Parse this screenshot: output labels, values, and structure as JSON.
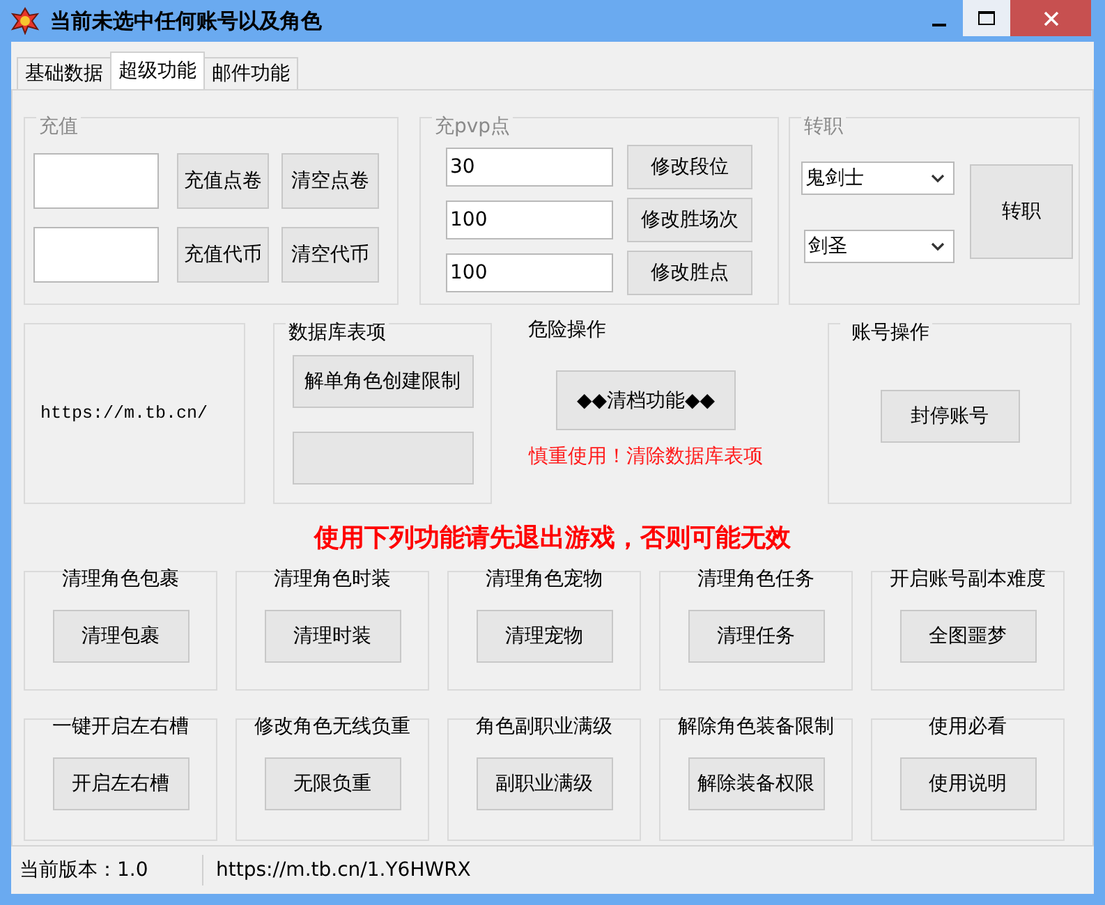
{
  "window": {
    "title": "当前未选中任何账号以及角色"
  },
  "tabs": [
    {
      "label": "基础数据",
      "selected": false
    },
    {
      "label": "超级功能",
      "selected": true
    },
    {
      "label": "邮件功能",
      "selected": false
    }
  ],
  "recharge": {
    "title": "充值",
    "disabled": true,
    "rows": [
      {
        "buttons": [
          "充值点卷",
          "清空点卷"
        ]
      },
      {
        "buttons": [
          "充值代币",
          "清空代币"
        ]
      }
    ]
  },
  "pvp": {
    "title": "充pvp点",
    "disabled": true,
    "rows": [
      {
        "value": "30",
        "button": "修改段位"
      },
      {
        "value": "100",
        "button": "修改胜场次"
      },
      {
        "value": "100",
        "button": "修改胜点"
      }
    ]
  },
  "job_change": {
    "title": "转职",
    "disabled": true,
    "selects": [
      {
        "value": "鬼剑士"
      },
      {
        "value": "剑圣"
      }
    ],
    "button": "转职"
  },
  "link_panel": {
    "text": "https://m.tb.cn/"
  },
  "database": {
    "title": "数据库表项",
    "disabled": false,
    "buttons": [
      {
        "kind": "text",
        "label": "解单角色创建限制"
      },
      {
        "kind": "blank"
      }
    ]
  },
  "danger": {
    "title": "危险操作",
    "button": "◆◆清档功能◆◆",
    "warning": "慎重使用！清除数据库表项"
  },
  "account": {
    "title": "账号操作",
    "disabled": false,
    "button": "封停账号"
  },
  "notice": "使用下列功能请先退出游戏，否则可能无效",
  "functions": [
    {
      "title": "清理角色包裹",
      "button": "清理包裹"
    },
    {
      "title": "清理角色时装",
      "button": "清理时装"
    },
    {
      "title": "清理角色宠物",
      "button": "清理宠物"
    },
    {
      "title": "清理角色任务",
      "button": "清理任务"
    },
    {
      "title": "开启账号副本难度",
      "button": "全图噩梦"
    },
    {
      "title": "一键开启左右槽",
      "button": "开启左右槽"
    },
    {
      "title": "修改角色无线负重",
      "button": "无限负重"
    },
    {
      "title": "角色副职业满级",
      "button": "副职业满级"
    },
    {
      "title": "解除角色装备限制",
      "button": "解除装备权限"
    },
    {
      "title": "使用必看",
      "button": "使用说明"
    }
  ],
  "status_bar": {
    "version": "当前版本：1.0",
    "link": "https://m.tb.cn/1.Y6HWRX"
  }
}
